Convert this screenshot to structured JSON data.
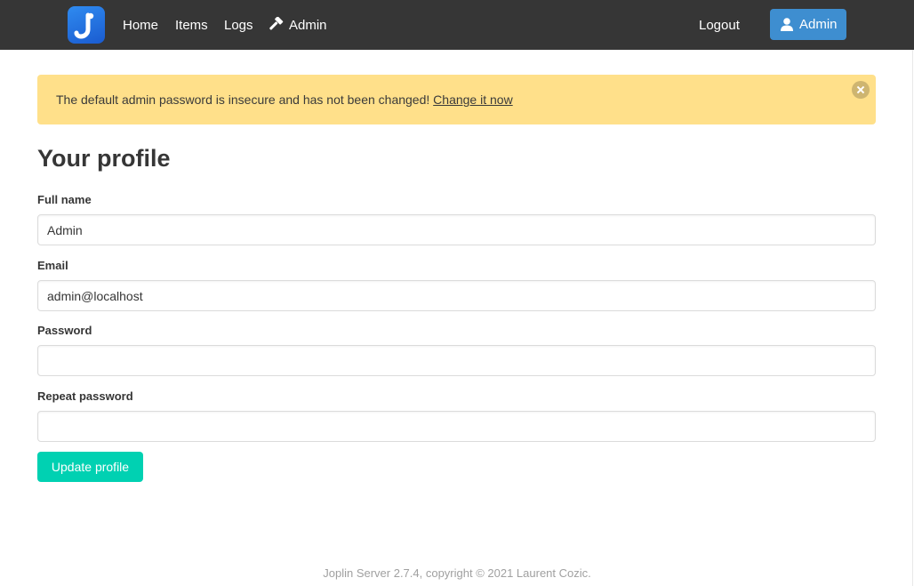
{
  "nav": {
    "logo_icon": "joplin-logo-icon",
    "links": {
      "home": "Home",
      "items": "Items",
      "logs": "Logs",
      "admin": "Admin"
    },
    "admin_icon": "hammer-icon",
    "logout": "Logout",
    "user_button": {
      "label": "Admin",
      "icon": "user-icon"
    }
  },
  "notification": {
    "message": "The default admin password is insecure and has not been changed! ",
    "link": "Change it now",
    "color": "#ffe08a"
  },
  "page": {
    "title": "Your profile"
  },
  "form": {
    "full_name": {
      "label": "Full name",
      "value": "Admin"
    },
    "email": {
      "label": "Email",
      "value": "admin@localhost"
    },
    "password": {
      "label": "Password",
      "value": ""
    },
    "repeat_password": {
      "label": "Repeat password",
      "value": ""
    },
    "submit_label": "Update profile"
  },
  "footer": {
    "text": "Joplin Server 2.7.4, copyright © 2021 Laurent Cozic."
  },
  "colors": {
    "navbar": "#363636",
    "primary": "#3e8ed0",
    "submit": "#00d1b2"
  }
}
